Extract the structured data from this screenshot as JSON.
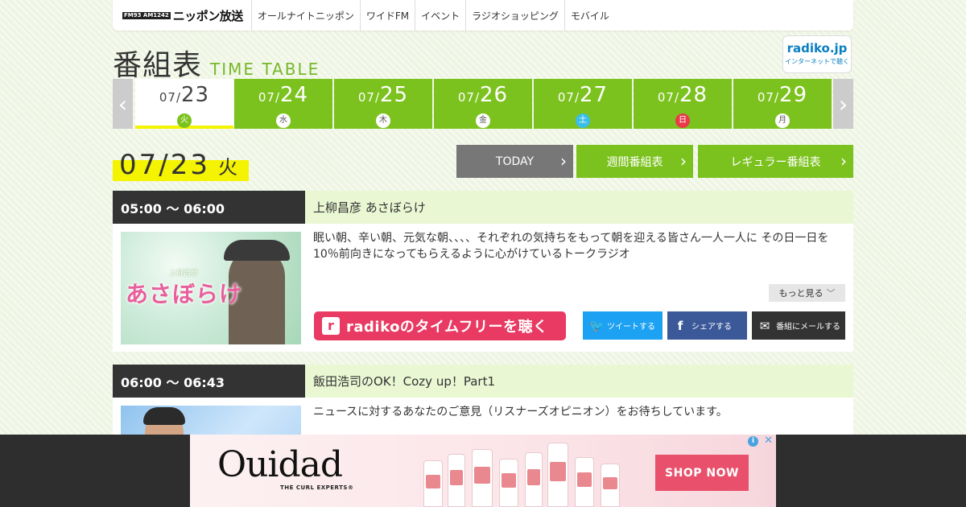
{
  "header": {
    "logo_freq": "FM93 AM1242",
    "logo_text": "ニッポン放送",
    "nav": [
      "オールナイトニッポン",
      "ワイドFM",
      "イベント",
      "ラジオショッピング",
      "モバイル"
    ]
  },
  "page_title": {
    "jp": "番組表",
    "en": "TIME TABLE"
  },
  "radiko_badge": {
    "main": "radiko.jp",
    "sub": "インターネットで聴く"
  },
  "date_tabs": [
    {
      "mm": "07/",
      "dd": "23",
      "dow": "火"
    },
    {
      "mm": "07/",
      "dd": "24",
      "dow": "水"
    },
    {
      "mm": "07/",
      "dd": "25",
      "dow": "木"
    },
    {
      "mm": "07/",
      "dd": "26",
      "dow": "金"
    },
    {
      "mm": "07/",
      "dd": "27",
      "dow": "土"
    },
    {
      "mm": "07/",
      "dd": "28",
      "dow": "日"
    },
    {
      "mm": "07/",
      "dd": "29",
      "dow": "月"
    }
  ],
  "tab_prev": "‹",
  "tab_next": "›",
  "current_date": {
    "md": "07/23",
    "dow": "火"
  },
  "buttons": {
    "today": "TODAY",
    "weekly": "週間番組表",
    "regular": "レギュラー番組表",
    "chevron": "›"
  },
  "programs": [
    {
      "time": "05:00 ～ 06:00",
      "title": "上柳昌彦 あさぼらけ",
      "description": "眠い朝、辛い朝、元気な朝、、、、それぞれの気持ちをもって朝を迎える皆さん一人一人に その日一日を10％前向きになってもらえるように心がけているトークラジオ",
      "thumb_text": "あさぼらけ",
      "thumb_small": "上柳昌彦",
      "more_label": "もっと見る",
      "radiko_label": "radikoのタイムフリーを聴く",
      "radiko_icon": "r",
      "share": {
        "tweet": "ツイートする",
        "facebook": "シェアする",
        "mail": "番組にメールする"
      }
    },
    {
      "time": "06:00 ～ 06:43",
      "title": "飯田浩司のOK！Cozy up！Part1",
      "description": "ニュースに対するあなたのご意見（リスナーズオピニオン）をお待ちしています。"
    }
  ],
  "ad": {
    "brand": "Ouidad",
    "tagline": "THE CURL EXPERTS®",
    "cta": "SHOP NOW",
    "info": "i",
    "close": "✕"
  },
  "colors": {
    "green": "#7cc21e",
    "yellow": "#f4f300",
    "radiko_pink": "#e83a62",
    "twitter": "#1da1f2",
    "facebook": "#3b5998"
  }
}
